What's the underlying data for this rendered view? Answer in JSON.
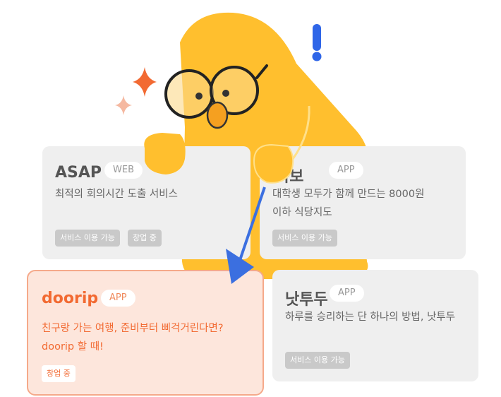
{
  "cards": [
    {
      "title": "ASAP",
      "tag": "WEB",
      "desc": [
        "최적의 회의시간 도출 서비스"
      ],
      "badges": [
        "서비스 이용 가능",
        "창업 중"
      ]
    },
    {
      "title": "족보",
      "tag": "APP",
      "desc": [
        "대학생 모두가 함께 만드는 8000원",
        "이하 식당지도"
      ],
      "badges": [
        "서비스 이용 가능"
      ]
    },
    {
      "title": "doorip",
      "tag": "APP",
      "desc": [
        "친구랑 가는 여행, 준비부터 삐걱거린다면?",
        "doorip 할 때!"
      ],
      "badges": [
        "창업 중"
      ]
    },
    {
      "title": "낫투두",
      "tag": "APP",
      "desc": [
        "하루를 승리하는 단 하나의 방법, 낫투두"
      ],
      "badges": [
        "서비스 이용 가능"
      ]
    }
  ],
  "colors": {
    "character": "#ffbf2e",
    "accent": "#f26a32",
    "arrow": "#3b6fe0",
    "exclaim": "#2f66e8"
  }
}
